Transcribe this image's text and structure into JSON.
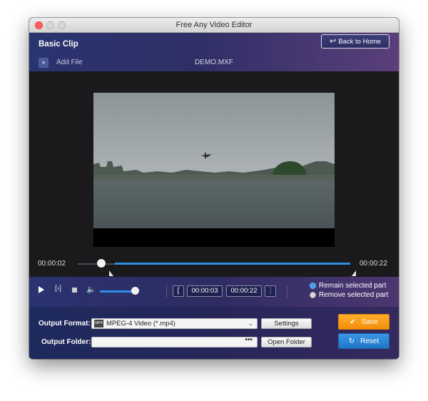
{
  "window": {
    "title": "Free Any Video Editor"
  },
  "header": {
    "title": "Basic Clip",
    "back_label": "Back to Home",
    "add_file_label": "Add File",
    "file_name": "DEMO.MXF"
  },
  "timeline": {
    "current_time": "00:00:02",
    "total_time": "00:00:22",
    "playhead_fraction": 0.09,
    "selection_start_fraction": 0.14,
    "selection_end_fraction": 1.0
  },
  "controls": {
    "volume_fraction": 0.85,
    "start_time": "00:00:03",
    "end_time": "00:00:22",
    "start_bracket": "[",
    "end_bracket": "]",
    "remain_label": "Remain selected part",
    "remove_label": "Remove selected part",
    "selected_option": "remain"
  },
  "output": {
    "format_label": "Output Format:",
    "format_value": "MPEG-4 Video (*.mp4)",
    "settings_label": "Settings",
    "folder_label": "Output Folder:",
    "folder_value": "",
    "folder_browse": "•••",
    "open_folder_label": "Open Folder",
    "save_label": "Save",
    "reset_label": "Reset"
  },
  "colors": {
    "accent_blue": "#2f8ce0",
    "save_orange": "#f5a11c",
    "reset_blue": "#2a84d6"
  }
}
